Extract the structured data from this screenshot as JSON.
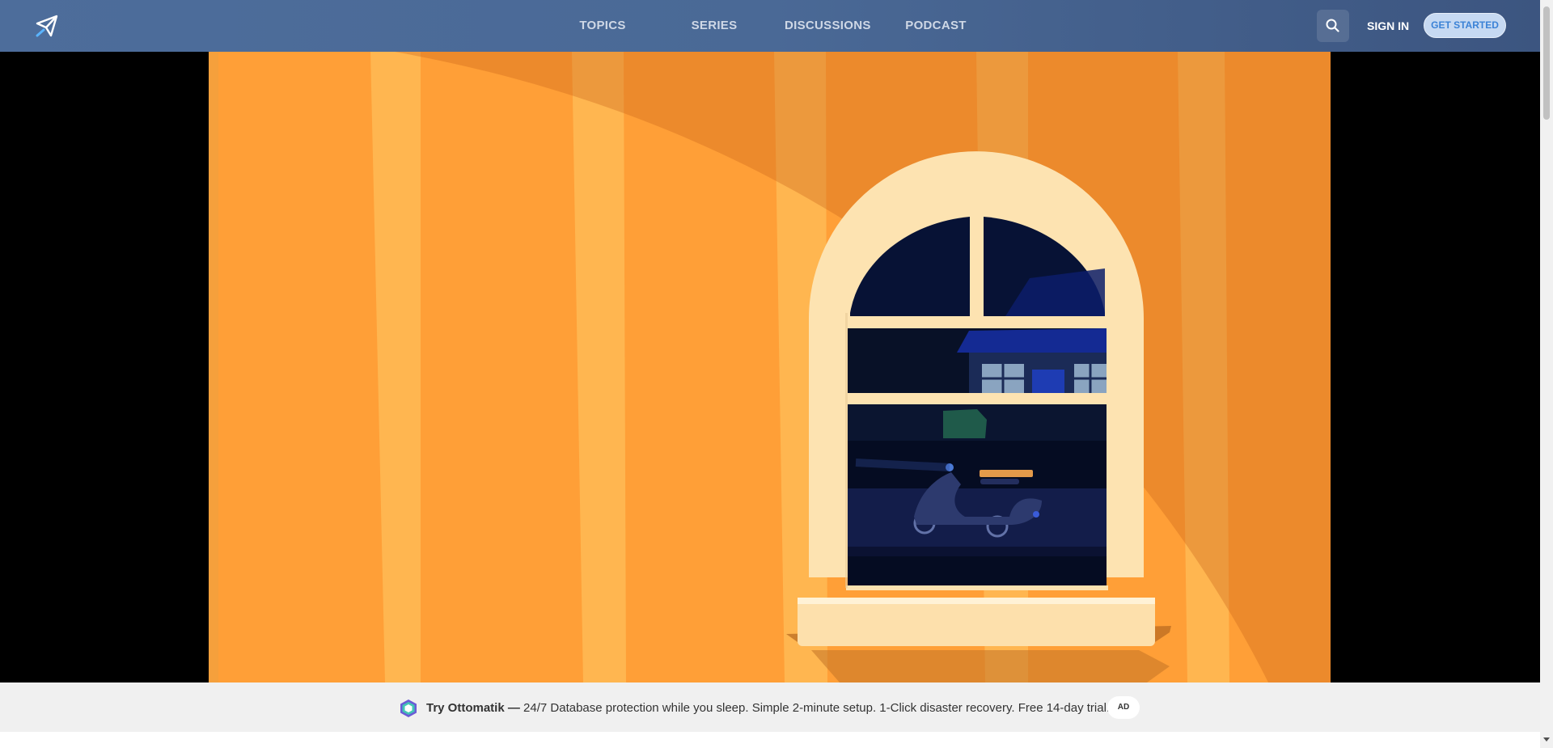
{
  "header": {
    "logo_icon": "paper-plane-logo-icon",
    "nav": [
      {
        "label": "TOPICS"
      },
      {
        "label": "SERIES"
      },
      {
        "label": "DISCUSSIONS"
      },
      {
        "label": "PODCAST"
      }
    ],
    "search_icon": "search-icon",
    "sign_in": "SIGN IN",
    "get_started": "GET STARTED"
  },
  "video": {
    "scene": "orange-curtain-window-night-scooter",
    "colors": {
      "curtain": "#ff9f37",
      "window_frame": "#fde3b1",
      "night": "#061028"
    }
  },
  "ad": {
    "logo_icon": "hexagon-logo-icon",
    "brand": "Try Ottomatik —",
    "text": " 24/7 Database protection while you sleep. Simple 2-minute setup. 1-Click disaster recovery. Free 14-day trial.",
    "badge": "AD"
  }
}
